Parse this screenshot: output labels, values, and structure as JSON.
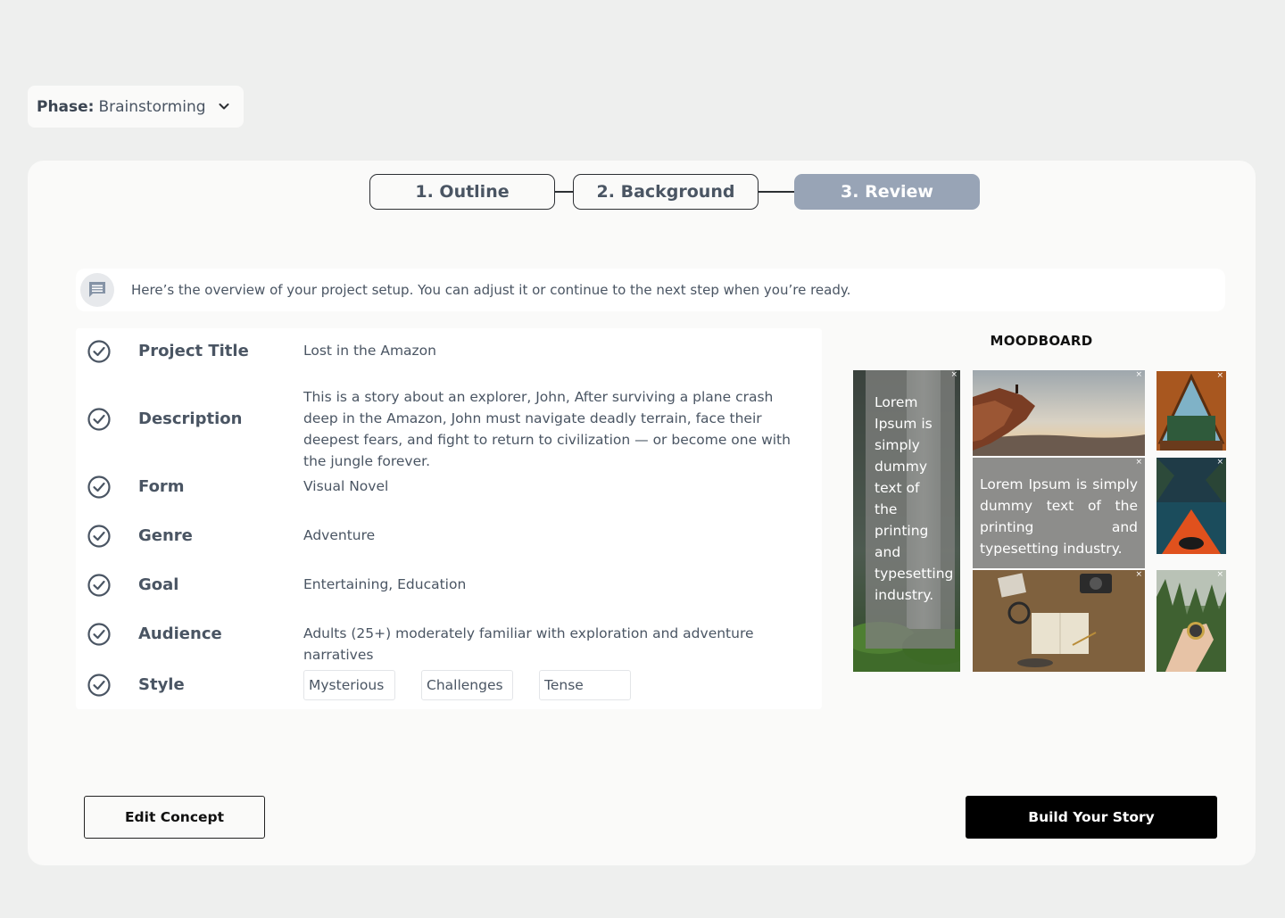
{
  "phase": {
    "label": "Phase:",
    "value": "Brainstorming"
  },
  "stepper": {
    "steps": [
      {
        "label": "1. Outline",
        "active": false
      },
      {
        "label": "2. Background",
        "active": false
      },
      {
        "label": "3. Review",
        "active": true
      }
    ]
  },
  "banner": {
    "message": "Here’s the overview of your project setup. You can adjust it or continue to the next step when you’re ready.",
    "icon": "chat-bubble-icon"
  },
  "details": {
    "project_title": {
      "label": "Project Title",
      "value": "Lost in the Amazon"
    },
    "description": {
      "label": "Description",
      "value": "This is a story about an explorer, John, After surviving a plane crash deep in the Amazon, John must navigate deadly terrain, face their deepest fears, and fight to return to civilization — or become one with the jungle forever."
    },
    "form": {
      "label": "Form",
      "value": "Visual Novel"
    },
    "genre": {
      "label": "Genre",
      "value": "Adventure"
    },
    "goal": {
      "label": "Goal",
      "value": "Entertaining, Education"
    },
    "audience": {
      "label": "Audience",
      "value": "Adults (25+) moderately familiar with exploration and adventure narratives"
    },
    "style": {
      "label": "Style",
      "tags": [
        "Mysterious",
        "Challenges",
        "Tense"
      ]
    }
  },
  "moodboard": {
    "title": "MOODBOARD",
    "overlay_text_tall": "Lorem Ipsum is simply dummy text of the printing and typesetting industry.",
    "overlay_text_wide": "Lorem Ipsum is simply dummy text of the printing and typesetting industry.",
    "close_glyph": "×"
  },
  "actions": {
    "edit_label": "Edit Concept",
    "build_label": "Build Your Story"
  },
  "colors": {
    "page_bg": "#eeefee",
    "card_bg": "#fafaf9",
    "active_step": "#98a4b6",
    "text": "#4a5563",
    "primary_button": "#000000"
  }
}
